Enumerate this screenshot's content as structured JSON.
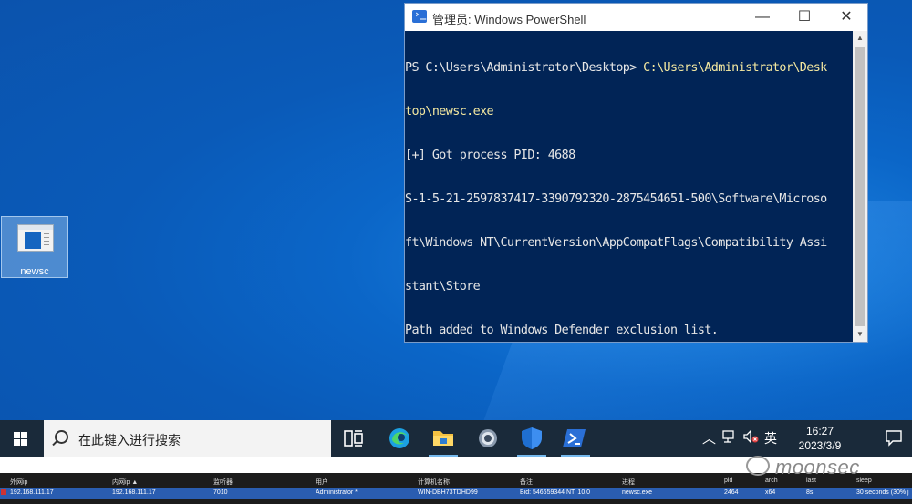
{
  "desktop": {
    "icon_label": "newsc"
  },
  "powershell": {
    "title": "管理员: Windows PowerShell",
    "buttons": {
      "minimize": "—",
      "maximize": "☐",
      "close": "✕"
    },
    "lines": [
      {
        "prefix": "PS C:\\Users\\Administrator\\Desktop> ",
        "cmd": "C:\\Users\\Administrator\\Desk"
      },
      {
        "prefix": "",
        "cmd": "top\\newsc.exe"
      },
      {
        "prefix": "[+] Got process PID: 4688",
        "cmd": ""
      },
      {
        "prefix": "S-1-5-21-2597837417-3390792320-2875454651-500\\Software\\Microso",
        "cmd": ""
      },
      {
        "prefix": "ft\\Windows NT\\CurrentVersion\\AppCompatFlags\\Compatibility Assi",
        "cmd": ""
      },
      {
        "prefix": "stant\\Store",
        "cmd": ""
      },
      {
        "prefix": "Path added to Windows Defender exclusion list.",
        "cmd": ""
      }
    ]
  },
  "taskbar": {
    "search_placeholder": "在此键入进行搜索",
    "apps": [
      "task-view",
      "edge",
      "file-explorer",
      "settings",
      "windows-security",
      "powershell"
    ],
    "tray": {
      "ime": "英",
      "time": "16:27",
      "date": "2023/3/9"
    }
  },
  "cs_table": {
    "headers": [
      "外网ip",
      "内网ip ▲",
      "监听器",
      "用户",
      "计算机名称",
      "备注",
      "进程",
      "pid",
      "arch",
      "last",
      "sleep"
    ],
    "row": [
      "192.168.111.17",
      "192.168.111.17",
      "7010",
      "Administrator *",
      "WIN-DBH73TDHD99",
      "Bid: 546659344  NT: 10.0",
      "newsc.exe",
      "2464",
      "x64",
      "8s",
      "30 seconds (30% j"
    ]
  },
  "watermark": "moonsec"
}
